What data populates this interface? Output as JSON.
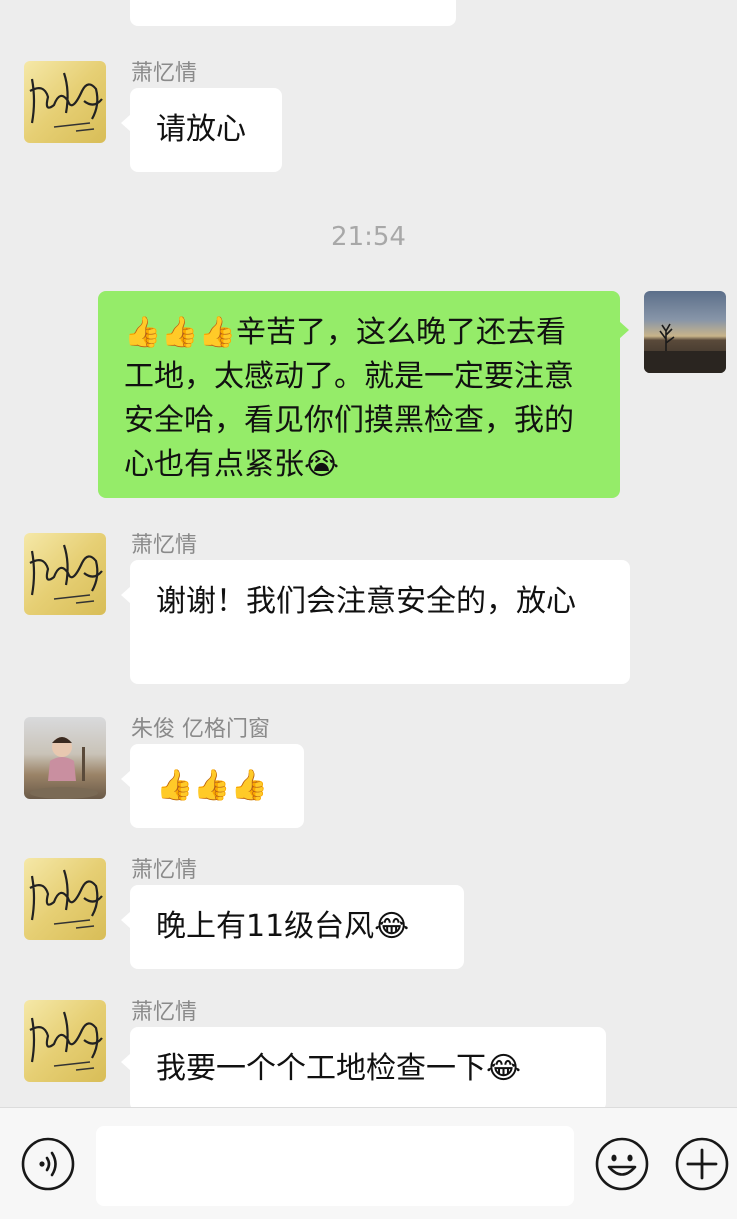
{
  "chat": {
    "timestamp": "21:54",
    "messages": [
      {
        "sender": "萧忆情",
        "text": "请放心"
      },
      {
        "text": "👍👍👍辛苦了，这么晚了还去看工地，太感动了。就是一定要注意安全哈，看见你们摸黑检查，我的心也有点紧张😭"
      },
      {
        "sender": "萧忆情",
        "text": "谢谢！我们会注意安全的，放心"
      },
      {
        "sender": "朱俊 亿格门窗",
        "text": "👍👍👍"
      },
      {
        "sender": "萧忆情",
        "text": "晚上有11级台风😂"
      },
      {
        "sender": "萧忆情",
        "text": "我要一个个工地检查一下😂"
      }
    ]
  },
  "input_bar": {
    "voice_icon": "voice-icon",
    "emoji_icon": "emoji-icon",
    "plus_icon": "plus-icon",
    "text_value": ""
  },
  "colors": {
    "background": "#ededed",
    "sent_bubble": "#95ec69",
    "received_bubble": "#ffffff"
  }
}
